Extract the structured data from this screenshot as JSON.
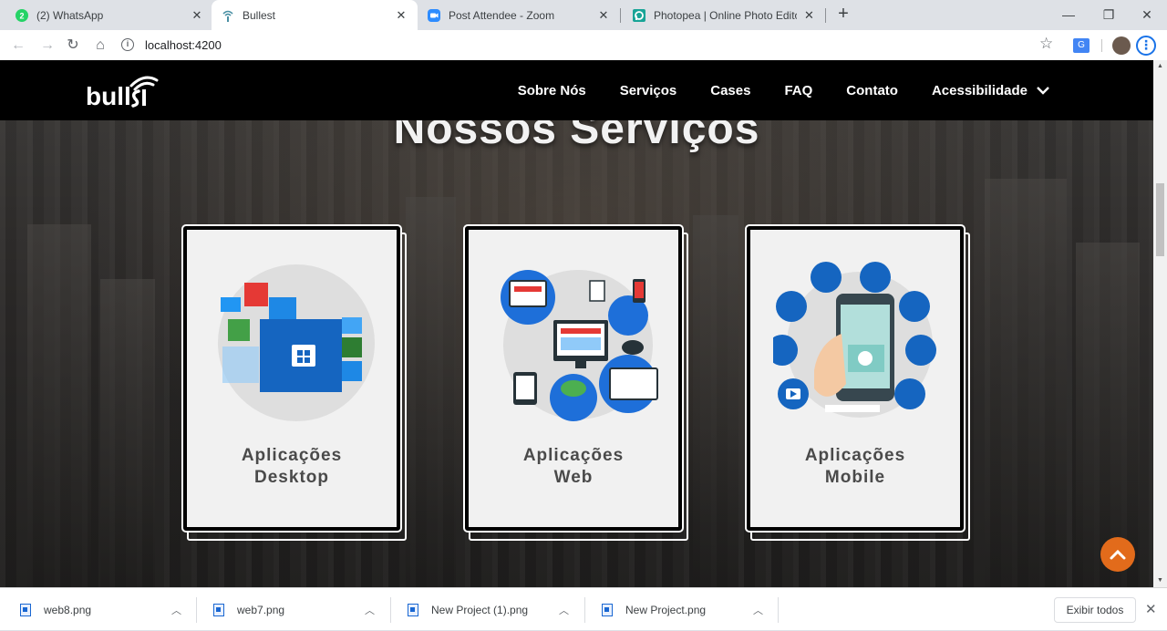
{
  "browser": {
    "tabs": [
      {
        "title": "(2) WhatsApp",
        "icon": "whatsapp-icon",
        "color": "#25d366",
        "badge": "2"
      },
      {
        "title": "Bullest",
        "icon": "bullest-icon",
        "color": "#4a90a4"
      },
      {
        "title": "Post Attendee - Zoom",
        "icon": "zoom-icon",
        "color": "#2d8cff"
      },
      {
        "title": "Photopea | Online Photo Editor",
        "icon": "photopea-icon",
        "color": "#18a497"
      }
    ],
    "close_glyph": "✕",
    "new_tab": "+",
    "url": "localhost:4200"
  },
  "site": {
    "nav": [
      "Sobre Nós",
      "Serviços",
      "Cases",
      "FAQ",
      "Contato",
      "Acessibilidade"
    ],
    "section_title": "Nossos Serviços",
    "cards": [
      {
        "line1": "Aplicações",
        "line2": "Desktop",
        "icon": "desktop-apps-illustration"
      },
      {
        "line1": "Aplicações",
        "line2": "Web",
        "icon": "web-apps-illustration"
      },
      {
        "line1": "Aplicações",
        "line2": "Mobile",
        "icon": "mobile-apps-illustration"
      }
    ],
    "accent": "#e26b1b"
  },
  "downloads": {
    "items": [
      "web8.png",
      "web7.png",
      "New Project (1).png",
      "New Project.png"
    ],
    "show_all": "Exibir todos"
  }
}
